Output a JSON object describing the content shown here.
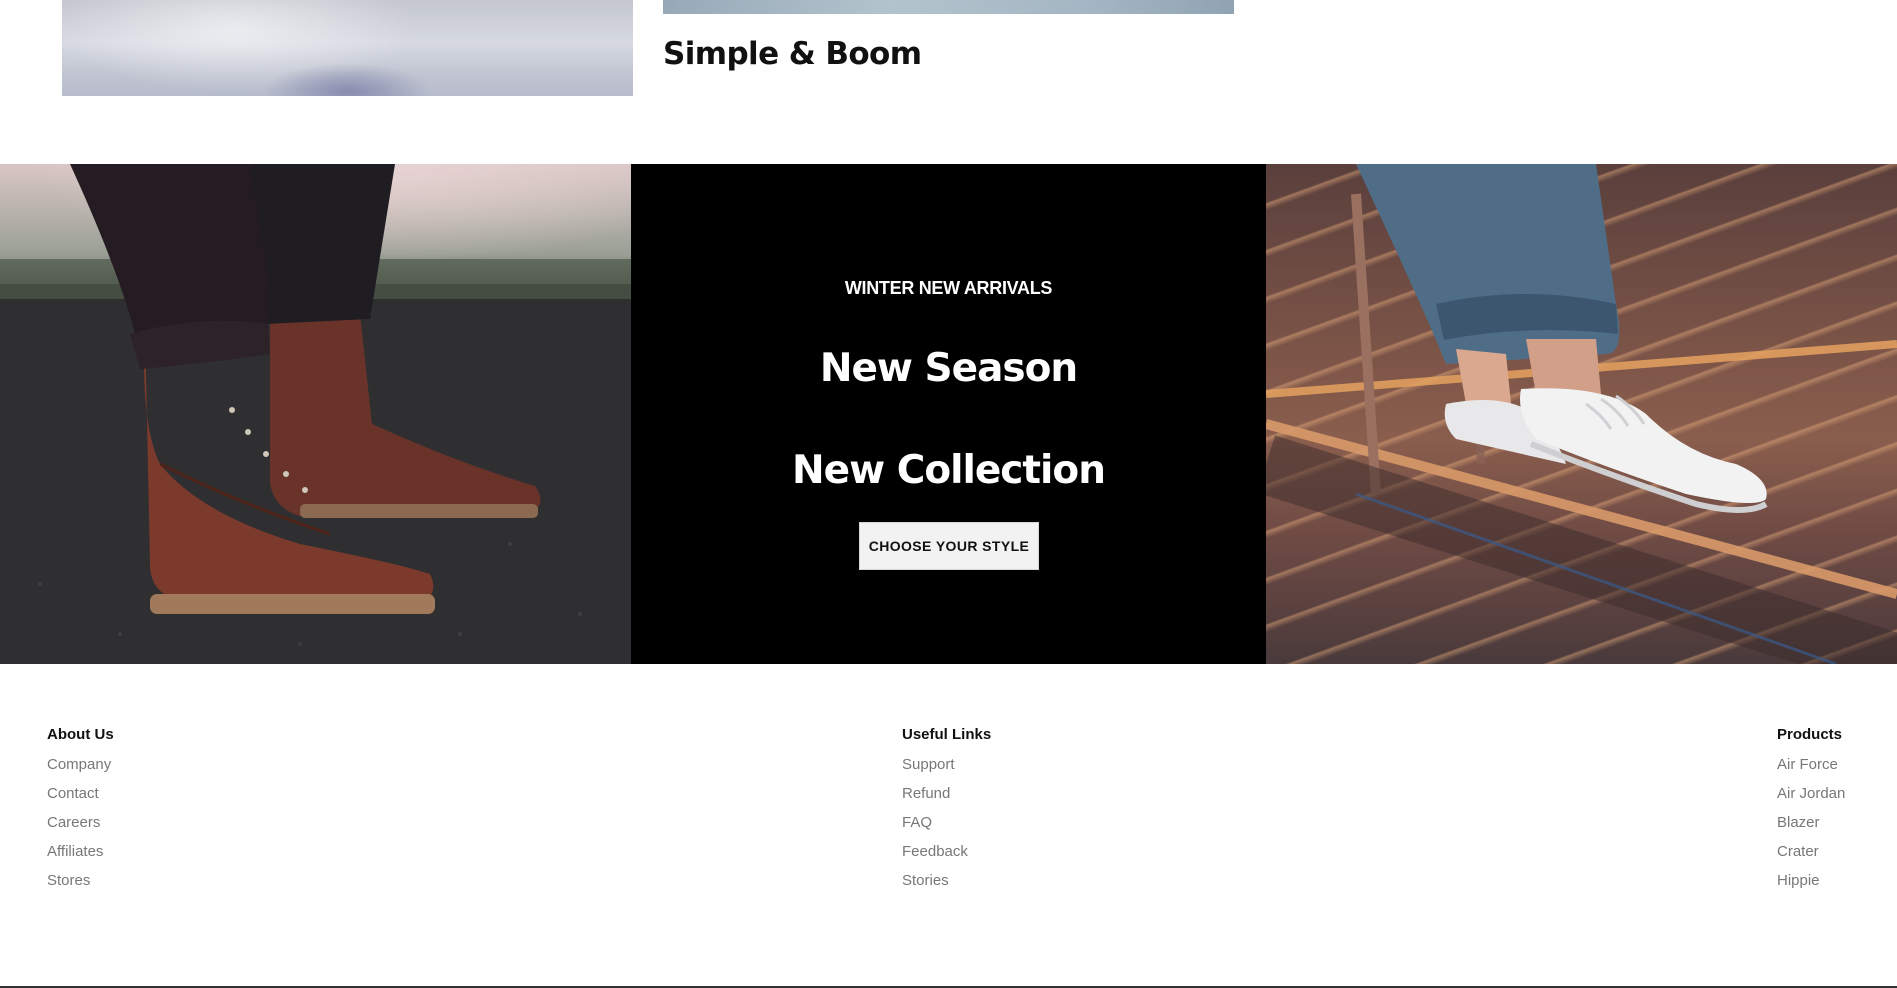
{
  "top_section": {
    "product_title": "Simple & Boom"
  },
  "banner": {
    "kicker": "WINTER NEW ARRIVALS",
    "headline_line1": "New Season",
    "headline_line2": "New Collection",
    "cta_label": "CHOOSE YOUR STYLE"
  },
  "footer": {
    "columns": [
      {
        "heading": "About Us",
        "links": [
          "Company",
          "Contact",
          "Careers",
          "Affiliates",
          "Stores"
        ]
      },
      {
        "heading": "Useful Links",
        "links": [
          "Support",
          "Refund",
          "FAQ",
          "Feedback",
          "Stories"
        ]
      },
      {
        "heading": "Products",
        "links": [
          "Air Force",
          "Air Jordan",
          "Blazer",
          "Crater",
          "Hippie"
        ]
      }
    ]
  }
}
